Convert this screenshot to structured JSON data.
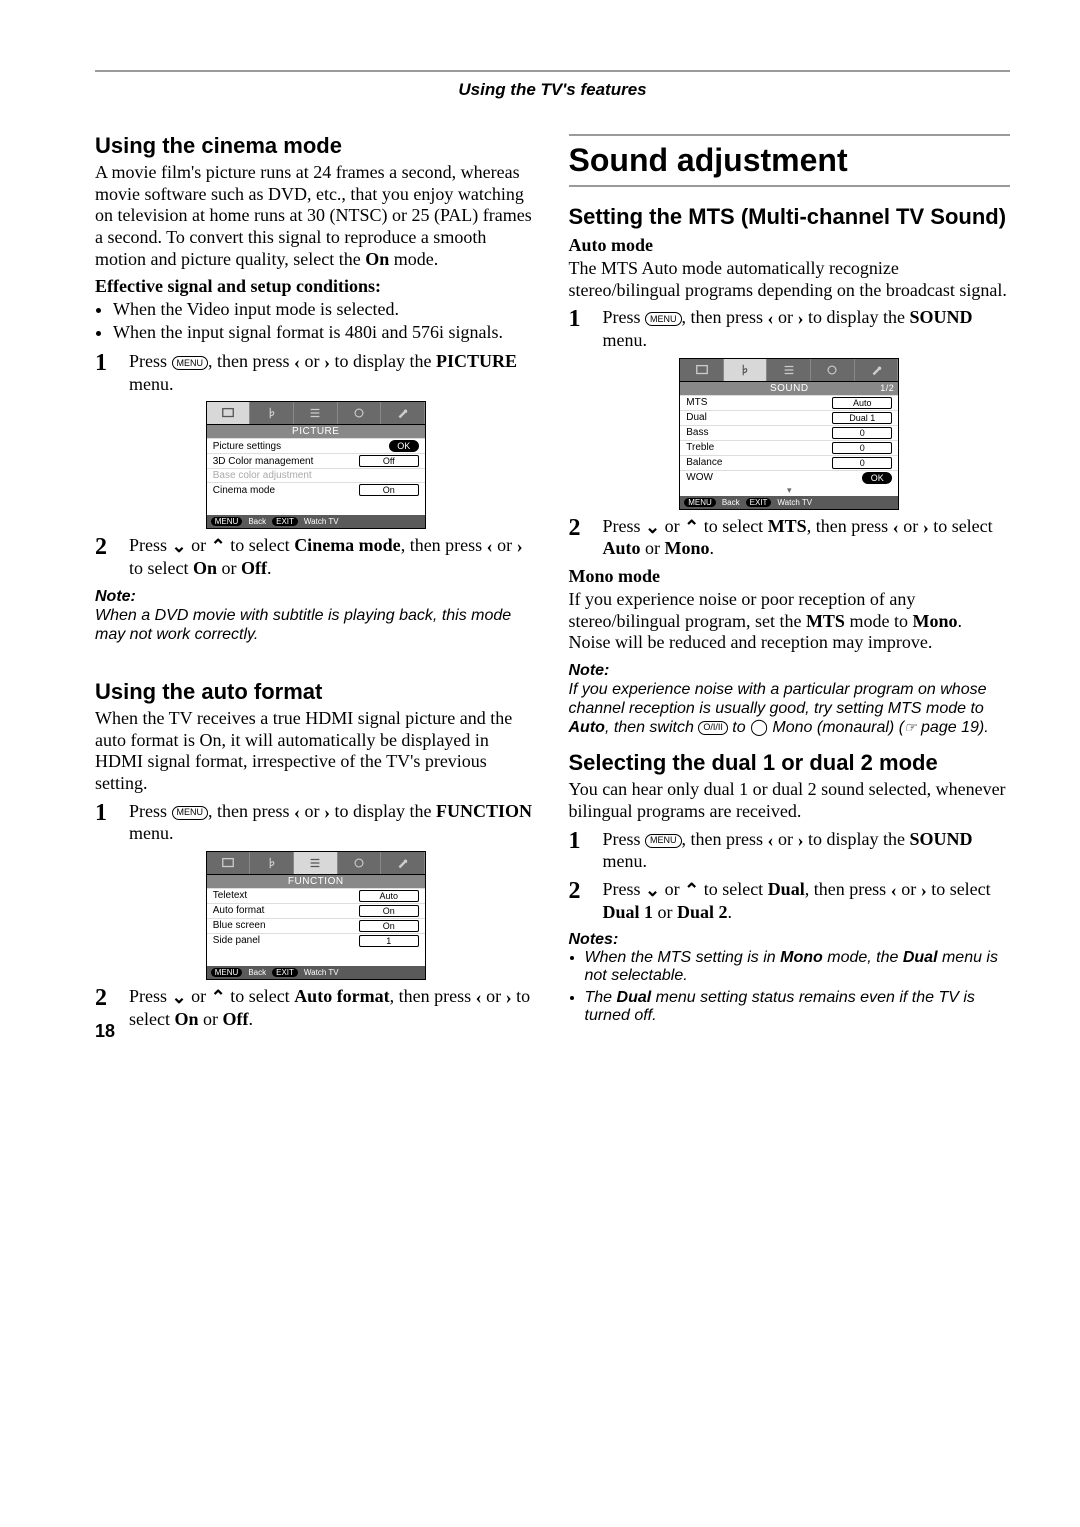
{
  "header": "Using the TV's features",
  "page_number": "18",
  "buttons": {
    "menu": "MENU",
    "audio": "O/I/II",
    "exit": "EXIT"
  },
  "glyphs": {
    "left": "‹",
    "right": "›",
    "down": "⌄",
    "up": "⌃"
  },
  "left": {
    "cinema": {
      "heading": "Using the cinema mode",
      "para": "A movie film's picture runs at 24 frames a second, whereas movie software such as DVD, etc., that you enjoy watching on television at home runs at 30 (NTSC) or 25 (PAL) frames a second. To convert this signal to reproduce a smooth motion and picture quality, select the ",
      "para_bold": "On",
      "para_tail": " mode.",
      "cond_heading": "Effective signal and setup conditions:",
      "cond1": "When the Video input mode is selected.",
      "cond2": "When the input signal format is 480i and 576i signals.",
      "step1_a": "Press ",
      "step1_b": ", then press ",
      "step1_c": " or ",
      "step1_d": " to display the ",
      "step1_e": "PICTURE",
      "step1_f": " menu.",
      "step2_a": "Press ",
      "step2_b": " or ",
      "step2_c": " to select ",
      "step2_d": "Cinema mode",
      "step2_e": ", then press ",
      "step2_f": " or ",
      "step2_g": " to select ",
      "step2_h": "On",
      "step2_i": " or ",
      "step2_j": "Off",
      "step2_k": ".",
      "note_hdr": "Note:",
      "note": "When a DVD movie with subtitle is playing back, this mode may not work correctly."
    },
    "auto": {
      "heading": "Using the auto format",
      "para": "When the TV receives a true HDMI signal picture and the auto format is On, it will automatically be displayed in HDMI signal format, irrespective of the TV's previous setting.",
      "step1_a": "Press ",
      "step1_b": ", then press ",
      "step1_c": " or ",
      "step1_d": " to display the ",
      "step1_e": "FUNCTION",
      "step1_f": " menu.",
      "step2_a": "Press ",
      "step2_b": " or ",
      "step2_c": " to select ",
      "step2_d": "Auto format",
      "step2_e": ", then press ",
      "step2_f": " or ",
      "step2_g": " to select ",
      "step2_h": "On",
      "step2_i": " or ",
      "step2_j": "Off",
      "step2_k": "."
    },
    "osd_picture": {
      "title": "PICTURE",
      "rows": [
        {
          "label": "Picture settings",
          "value": "OK",
          "ok": true
        },
        {
          "label": "3D Color management",
          "value": "Off"
        },
        {
          "label": "Base color adjustment",
          "value": "",
          "dim": true
        },
        {
          "label": "Cinema mode",
          "value": "On"
        }
      ],
      "foot_back": "Back",
      "foot_watch": "Watch TV"
    },
    "osd_function": {
      "title": "FUNCTION",
      "rows": [
        {
          "label": "Teletext",
          "value": "Auto"
        },
        {
          "label": "Auto format",
          "value": "On"
        },
        {
          "label": "Blue screen",
          "value": "On"
        },
        {
          "label": "Side panel",
          "value": "1"
        }
      ],
      "foot_back": "Back",
      "foot_watch": "Watch TV"
    }
  },
  "right": {
    "h1": "Sound adjustment",
    "mts": {
      "heading": "Setting the MTS (Multi-channel TV Sound)",
      "auto_hdr": "Auto mode",
      "auto_para": "The MTS Auto mode automatically recognize stereo/bilingual programs depending on the broadcast signal.",
      "step1_a": "Press ",
      "step1_b": ", then press ",
      "step1_c": " or ",
      "step1_d": " to display the ",
      "step1_e": "SOUND",
      "step1_f": " menu.",
      "step2_a": "Press ",
      "step2_b": " or ",
      "step2_c": " to select ",
      "step2_d": "MTS",
      "step2_e": ", then press ",
      "step2_f": " or ",
      "step2_g": " to select ",
      "step2_h": "Auto",
      "step2_i": " or ",
      "step2_j": "Mono",
      "step2_k": ".",
      "mono_hdr": "Mono mode",
      "mono_p1": "If you experience noise or poor reception of any stereo/bilingual program, set the ",
      "mono_b1": "MTS",
      "mono_p2": " mode to ",
      "mono_b2": "Mono",
      "mono_p3": ".",
      "mono_p4": "Noise will be reduced and reception may improve.",
      "note_hdr": "Note:",
      "note_a": "If you experience noise with a particular program on whose channel reception is usually good, try setting MTS mode to ",
      "note_b1": "Auto",
      "note_b2": ", then switch ",
      "note_b3": " to ",
      "note_b4": " Mono (monaural) (",
      "note_b5": " page 19)."
    },
    "dual": {
      "heading": "Selecting the dual 1 or dual 2 mode",
      "para": "You can hear only dual 1 or dual 2 sound selected, whenever bilingual programs are received.",
      "step1_a": "Press ",
      "step1_b": ", then press ",
      "step1_c": " or ",
      "step1_d": " to display the ",
      "step1_e": "SOUND",
      "step1_f": " menu.",
      "step2_a": "Press ",
      "step2_b": " or ",
      "step2_c": " to select ",
      "step2_d": "Dual",
      "step2_e": ", then press ",
      "step2_f": " or ",
      "step2_g": " to select ",
      "step2_h": "Dual 1",
      "step2_i": " or ",
      "step2_j": "Dual 2",
      "step2_k": ".",
      "notes_hdr": "Notes:",
      "note1_a": "When the MTS setting is in ",
      "note1_b": "Mono",
      "note1_c": " mode, the ",
      "note1_d": "Dual",
      "note1_e": " menu is not selectable.",
      "note2_a": "The ",
      "note2_b": "Dual",
      "note2_c": " menu setting status remains even if the TV is turned off."
    },
    "osd_sound": {
      "title": "SOUND",
      "pagect": "1/2",
      "rows": [
        {
          "label": "MTS",
          "value": "Auto"
        },
        {
          "label": "Dual",
          "value": "Dual 1"
        },
        {
          "label": "Bass",
          "value": "0"
        },
        {
          "label": "Treble",
          "value": "0"
        },
        {
          "label": "Balance",
          "value": "0"
        },
        {
          "label": "WOW",
          "value": "OK",
          "ok": true
        }
      ],
      "foot_back": "Back",
      "foot_watch": "Watch TV"
    }
  }
}
